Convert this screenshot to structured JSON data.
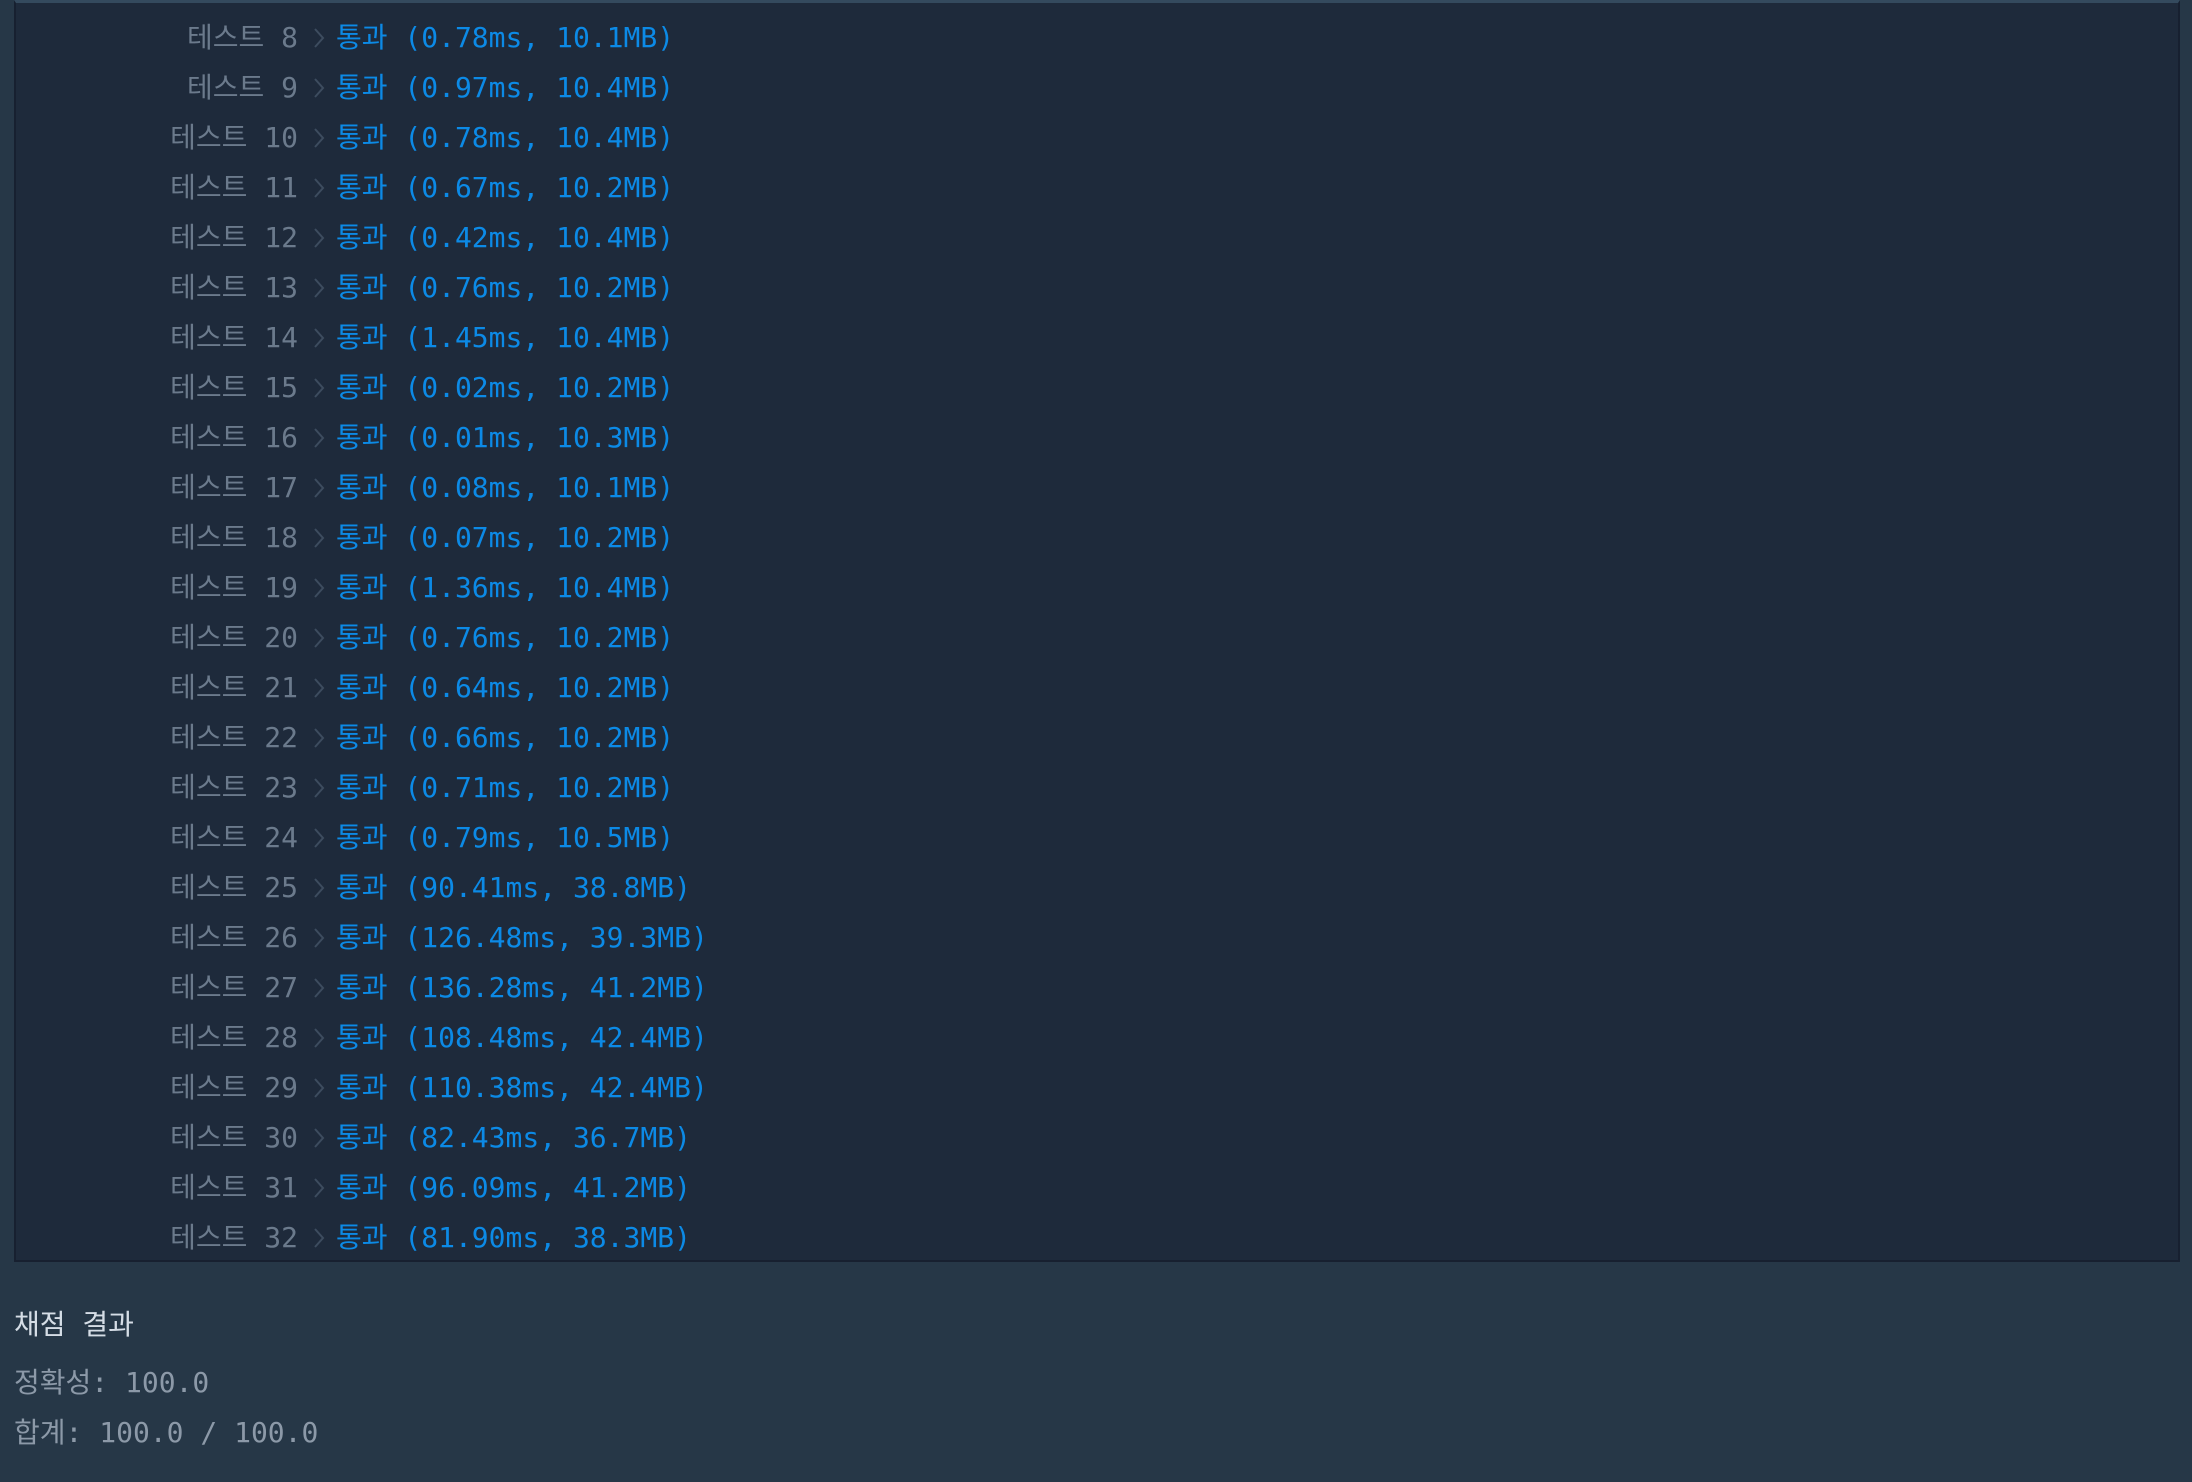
{
  "results": {
    "rows": [
      {
        "label": "테스트 8",
        "status": "통과 (0.78ms, 10.1MB)"
      },
      {
        "label": "테스트 9",
        "status": "통과 (0.97ms, 10.4MB)"
      },
      {
        "label": "테스트 10",
        "status": "통과 (0.78ms, 10.4MB)"
      },
      {
        "label": "테스트 11",
        "status": "통과 (0.67ms, 10.2MB)"
      },
      {
        "label": "테스트 12",
        "status": "통과 (0.42ms, 10.4MB)"
      },
      {
        "label": "테스트 13",
        "status": "통과 (0.76ms, 10.2MB)"
      },
      {
        "label": "테스트 14",
        "status": "통과 (1.45ms, 10.4MB)"
      },
      {
        "label": "테스트 15",
        "status": "통과 (0.02ms, 10.2MB)"
      },
      {
        "label": "테스트 16",
        "status": "통과 (0.01ms, 10.3MB)"
      },
      {
        "label": "테스트 17",
        "status": "통과 (0.08ms, 10.1MB)"
      },
      {
        "label": "테스트 18",
        "status": "통과 (0.07ms, 10.2MB)"
      },
      {
        "label": "테스트 19",
        "status": "통과 (1.36ms, 10.4MB)"
      },
      {
        "label": "테스트 20",
        "status": "통과 (0.76ms, 10.2MB)"
      },
      {
        "label": "테스트 21",
        "status": "통과 (0.64ms, 10.2MB)"
      },
      {
        "label": "테스트 22",
        "status": "통과 (0.66ms, 10.2MB)"
      },
      {
        "label": "테스트 23",
        "status": "통과 (0.71ms, 10.2MB)"
      },
      {
        "label": "테스트 24",
        "status": "통과 (0.79ms, 10.5MB)"
      },
      {
        "label": "테스트 25",
        "status": "통과 (90.41ms, 38.8MB)"
      },
      {
        "label": "테스트 26",
        "status": "통과 (126.48ms, 39.3MB)"
      },
      {
        "label": "테스트 27",
        "status": "통과 (136.28ms, 41.2MB)"
      },
      {
        "label": "테스트 28",
        "status": "통과 (108.48ms, 42.4MB)"
      },
      {
        "label": "테스트 29",
        "status": "통과 (110.38ms, 42.4MB)"
      },
      {
        "label": "테스트 30",
        "status": "통과 (82.43ms, 36.7MB)"
      },
      {
        "label": "테스트 31",
        "status": "통과 (96.09ms, 41.2MB)"
      },
      {
        "label": "테스트 32",
        "status": "통과 (81.90ms, 38.3MB)"
      }
    ]
  },
  "summary": {
    "title": "채점 결과",
    "accuracy": "정확성: 100.0",
    "total": "합계: 100.0 / 100.0"
  },
  "icons": {
    "separator": "chevron-right-icon"
  },
  "colors": {
    "page_bg": "#263747",
    "console_bg": "#1e2a3b",
    "pass": "#0c8ae6",
    "label": "#6b7a8c"
  }
}
